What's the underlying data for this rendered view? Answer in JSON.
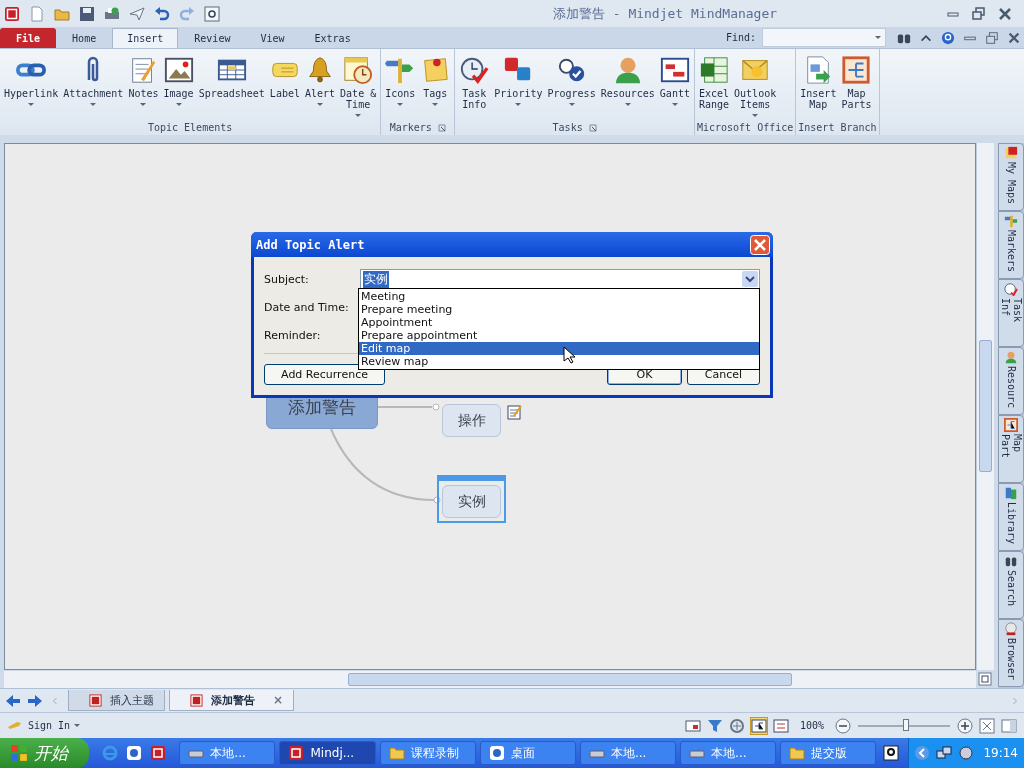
{
  "window": {
    "title": "添加警告 - Mindjet MindManager"
  },
  "tabs": [
    {
      "label": "File",
      "kind": "file",
      "selected": false
    },
    {
      "label": "Home",
      "kind": "tab",
      "selected": false
    },
    {
      "label": "Insert",
      "kind": "tab",
      "selected": true
    },
    {
      "label": "Review",
      "kind": "tab",
      "selected": false
    },
    {
      "label": "View",
      "kind": "tab",
      "selected": false
    },
    {
      "label": "Extras",
      "kind": "tab",
      "selected": false
    }
  ],
  "find": {
    "label": "Find:"
  },
  "ribbon": {
    "groups": [
      {
        "label": "Topic Elements",
        "launcher": false,
        "buttons": [
          {
            "label": "Hyperlink",
            "kind": "hyperlink",
            "dropdown": true
          },
          {
            "label": "Attachment",
            "kind": "attachment",
            "dropdown": true
          },
          {
            "label": "Notes",
            "kind": "notes",
            "dropdown": true
          },
          {
            "label": "Image",
            "kind": "image",
            "dropdown": true
          },
          {
            "label": "Spreadsheet",
            "kind": "spreadsheet",
            "dropdown": false
          },
          {
            "label": "Label",
            "kind": "label",
            "dropdown": false
          },
          {
            "label": "Alert",
            "kind": "alert",
            "dropdown": true
          },
          {
            "label": "Date &\nTime",
            "kind": "datetime",
            "dropdown": true
          }
        ]
      },
      {
        "label": "Markers",
        "launcher": true,
        "buttons": [
          {
            "label": "Icons",
            "kind": "icons",
            "dropdown": true
          },
          {
            "label": "Tags",
            "kind": "tags",
            "dropdown": true
          }
        ]
      },
      {
        "label": "Tasks",
        "launcher": true,
        "buttons": [
          {
            "label": "Task\nInfo",
            "kind": "taskinfo",
            "dropdown": false
          },
          {
            "label": "Priority",
            "kind": "priority",
            "dropdown": true
          },
          {
            "label": "Progress",
            "kind": "progress",
            "dropdown": true
          },
          {
            "label": "Resources",
            "kind": "resources",
            "dropdown": true
          },
          {
            "label": "Gantt",
            "kind": "gantt",
            "dropdown": true
          }
        ]
      },
      {
        "label": "Microsoft Office",
        "launcher": false,
        "buttons": [
          {
            "label": "Excel\nRange",
            "kind": "excel",
            "dropdown": false
          },
          {
            "label": "Outlook\nItems",
            "kind": "outlook",
            "dropdown": true
          }
        ]
      },
      {
        "label": "Insert Branch",
        "launcher": false,
        "buttons": [
          {
            "label": "Insert\nMap",
            "kind": "insertmap",
            "dropdown": false
          },
          {
            "label": "Map\nParts",
            "kind": "mapparts",
            "dropdown": false
          }
        ]
      }
    ]
  },
  "map": {
    "central": {
      "text": "添加警告"
    },
    "topics": [
      {
        "text": "操作",
        "notes": true,
        "selected": false
      },
      {
        "text": "实例",
        "notes": false,
        "selected": true
      }
    ]
  },
  "dialog": {
    "title": "Add Topic Alert",
    "subject_label": "Subject:",
    "subject_value": "实例",
    "date_label": "Date and Time:",
    "reminder_label": "Reminder:",
    "options": [
      {
        "label": "Meeting",
        "selected": false
      },
      {
        "label": "Prepare meeting",
        "selected": false
      },
      {
        "label": "Appointment",
        "selected": false
      },
      {
        "label": "Prepare appointment",
        "selected": false
      },
      {
        "label": "Edit map",
        "selected": true
      },
      {
        "label": "Review map",
        "selected": false
      }
    ],
    "buttons": [
      {
        "label": "Add Recurrence",
        "default": false
      },
      {
        "label": "OK",
        "default": true
      },
      {
        "label": "Cancel",
        "default": false
      }
    ]
  },
  "side_tabs": [
    {
      "label": "My Maps",
      "kind": "mymaps"
    },
    {
      "label": "Markers",
      "kind": "markers"
    },
    {
      "label": "Task Inf",
      "kind": "taskinfo"
    },
    {
      "label": "Resourc",
      "kind": "resources"
    },
    {
      "label": "Map Part",
      "kind": "mapparts"
    },
    {
      "label": "Library",
      "kind": "library"
    },
    {
      "label": "Search",
      "kind": "search"
    },
    {
      "label": "Browser",
      "kind": "browser"
    }
  ],
  "doc_tabs": [
    {
      "label": "插入主题",
      "selected": false
    },
    {
      "label": "添加警告",
      "selected": true,
      "close": "×"
    }
  ],
  "status_bar": {
    "sign_in": "Sign In",
    "zoom": "100%",
    "level": 0.52
  },
  "taskbar": {
    "start": "开始",
    "tasks": [
      {
        "label": "本地...",
        "kind": "drive",
        "selected": false
      },
      {
        "label": "Mindj...",
        "kind": "app",
        "selected": true
      },
      {
        "label": "课程录制",
        "kind": "folder",
        "selected": false
      },
      {
        "label": "桌面",
        "kind": "ie",
        "selected": false
      },
      {
        "label": "本地...",
        "kind": "drive",
        "selected": false
      },
      {
        "label": "本地...",
        "kind": "drive",
        "selected": false
      },
      {
        "label": "提交版",
        "kind": "folder",
        "selected": false
      }
    ],
    "clock": "19:14"
  }
}
